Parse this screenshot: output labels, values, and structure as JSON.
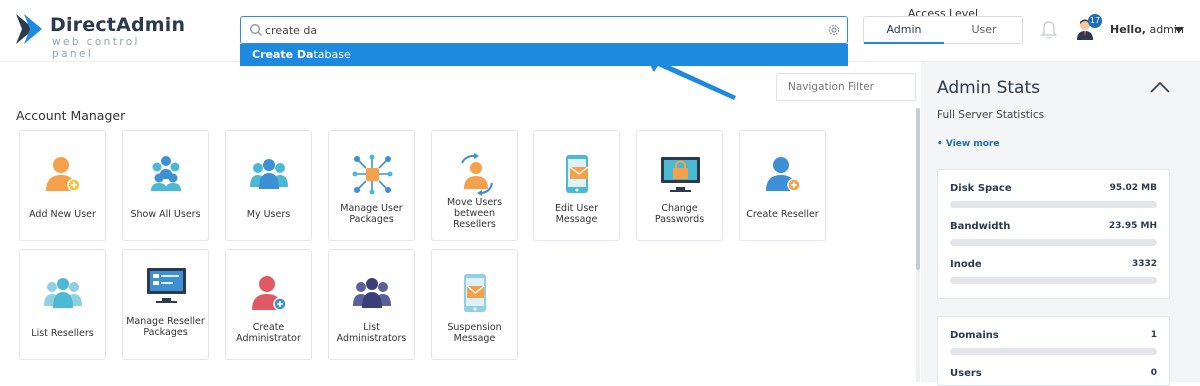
{
  "brand": {
    "title": "DirectAdmin",
    "subtitle": "web control panel"
  },
  "search": {
    "value": "create da",
    "suggestion_bold": "Create Da",
    "suggestion_rest": "tabase"
  },
  "access": {
    "title": "Access Level",
    "admin": "Admin",
    "user": "User"
  },
  "user": {
    "notifications": "17",
    "hello": "Hello,",
    "name": "admin"
  },
  "nav_filter": {
    "placeholder": "Navigation Filter"
  },
  "account_manager": {
    "title": "Account Manager",
    "tiles": [
      {
        "label": "Add New User",
        "icon": "add-user-icon"
      },
      {
        "label": "Show All Users",
        "icon": "users-group-icon"
      },
      {
        "label": "My Users",
        "icon": "my-users-icon"
      },
      {
        "label": "Manage User Packages",
        "icon": "packages-icon"
      },
      {
        "label": "Move Users between Resellers",
        "icon": "move-users-icon"
      },
      {
        "label": "Edit User Message",
        "icon": "mobile-message-icon"
      },
      {
        "label": "Change Passwords",
        "icon": "monitor-lock-icon"
      },
      {
        "label": "Create Reseller",
        "icon": "create-reseller-icon"
      },
      {
        "label": "List Resellers",
        "icon": "resellers-group-icon"
      },
      {
        "label": "Manage Reseller Packages",
        "icon": "monitor-panel-icon"
      },
      {
        "label": "Create Administrator",
        "icon": "create-admin-icon"
      },
      {
        "label": "List Administrators",
        "icon": "admins-group-icon"
      },
      {
        "label": "Suspension Message",
        "icon": "suspension-message-icon"
      }
    ]
  },
  "admin_stats": {
    "title": "Admin Stats",
    "subtitle": "Full Server Statistics",
    "view_more": "• View more",
    "stats": [
      {
        "name": "Disk Space",
        "value": "95.02 MB"
      },
      {
        "name": "Bandwidth",
        "value": "23.95 MH"
      },
      {
        "name": "Inode",
        "value": "3332"
      }
    ],
    "stats2": [
      {
        "name": "Domains",
        "value": "1"
      },
      {
        "name": "Users",
        "value": "0"
      }
    ]
  },
  "colors": {
    "accent": "#1d8ae0",
    "orange": "#f5a04a",
    "teal": "#4bb8d4",
    "red": "#e05a63",
    "navy": "#3a3f7a"
  }
}
